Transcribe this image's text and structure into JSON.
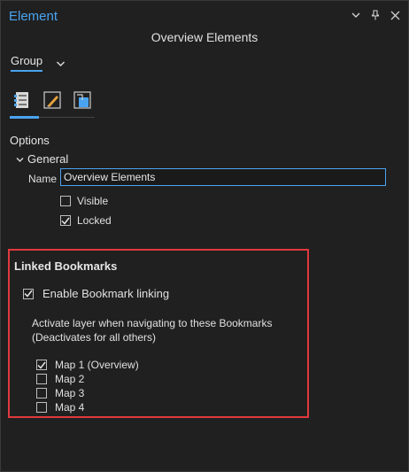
{
  "window": {
    "title": "Element",
    "subtitle": "Overview Elements"
  },
  "tabs": {
    "group_label": "Group"
  },
  "icons": [
    "properties-icon",
    "symbol-edit-icon",
    "display-icon"
  ],
  "options": {
    "heading": "Options",
    "general": {
      "heading": "General",
      "name_label": "Name",
      "name_value": "Overview Elements",
      "visible_label": "Visible",
      "visible_checked": false,
      "locked_label": "Locked",
      "locked_checked": true
    }
  },
  "linked_bookmarks": {
    "title": "Linked Bookmarks",
    "enable_label": "Enable Bookmark linking",
    "enable_checked": true,
    "description_line1": "Activate layer when navigating to these Bookmarks",
    "description_line2": "(Deactivates for all others)",
    "maps": [
      {
        "label": "Map 1 (Overview)",
        "checked": true
      },
      {
        "label": "Map 2",
        "checked": false
      },
      {
        "label": "Map 3",
        "checked": false
      },
      {
        "label": "Map 4",
        "checked": false
      }
    ]
  },
  "colors": {
    "accent": "#4aa3f0",
    "highlight": "#e0393e",
    "background": "#202020"
  }
}
